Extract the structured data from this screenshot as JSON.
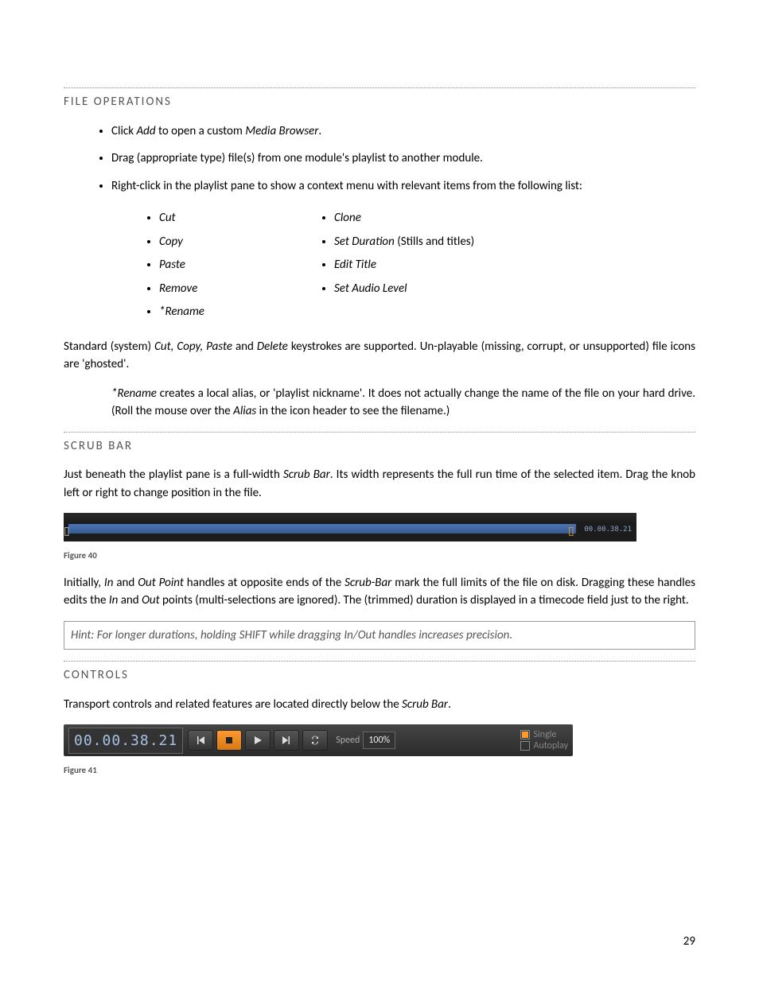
{
  "sections": {
    "file_ops": "FILE OPERATIONS",
    "scrub": "SCRUB BAR",
    "controls": "CONTROLS"
  },
  "file_ops_bullets": {
    "b1_pre": "Click ",
    "b1_add": "Add",
    "b1_mid": " to open a custom ",
    "b1_mb": "Media Browser",
    "b1_post": ".",
    "b2": "Drag (appropriate type) file(s) from one module's playlist to another module.",
    "b3": "Right-click in the playlist pane to show a context menu with relevant items from the following list:"
  },
  "ctx_col1": [
    "Cut",
    "Copy",
    "Paste",
    "Remove",
    "*Rename"
  ],
  "ctx_col2": [
    {
      "t": "Clone",
      "n": ""
    },
    {
      "t": "Set Duration",
      "n": " (Stills and titles)"
    },
    {
      "t": "Edit Title",
      "n": ""
    },
    {
      "t": "Set Audio Level",
      "n": ""
    }
  ],
  "para_std": {
    "a": "Standard (system) ",
    "b": "Cut, Copy, Paste",
    "c": " and ",
    "d": "Delete",
    "e": " keystrokes are supported. Un-playable (missing, corrupt, or unsupported) file icons are 'ghosted'."
  },
  "para_rename": {
    "a": "*Rename",
    "b": " creates a local alias, or 'playlist nickname'.  It does not actually change the name of the file on your hard drive.  (Roll the mouse over the ",
    "c": "Alias",
    "d": " in the icon header to see the filename.)"
  },
  "scrub_intro": {
    "a": "Just beneath the playlist pane is a full-width ",
    "b": "Scrub Bar",
    "c": ".  Its width represents the full run time of the selected item.  Drag the knob left or right to change position in the file."
  },
  "scrub_tc": "00.00.38.21",
  "fig40": "Figure 40",
  "scrub_after": {
    "a": "Initially, ",
    "b": "In",
    "c": " and ",
    "d": "Out Point",
    "e": " handles at opposite ends of the ",
    "f": "Scrub-Bar",
    "g": " mark the full limits of the file on disk.  Dragging these handles edits the ",
    "h": "In",
    "i": " and ",
    "j": "Out",
    "k": " points (multi-selections are ignored).  The (trimmed) duration is displayed in a timecode field just to the right."
  },
  "hint": "Hint: For longer durations, holding SHIFT while dragging In/Out handles increases precision.",
  "controls_intro": {
    "a": "Transport controls and related features are located directly below the ",
    "b": "Scrub Bar",
    "c": "."
  },
  "ctrl_tc": "00.00.38.21",
  "speed_label": "Speed",
  "speed_value": "100%",
  "opt_single": "Single",
  "opt_autoplay": "Autoplay",
  "fig41": "Figure 41",
  "page_num": "29"
}
